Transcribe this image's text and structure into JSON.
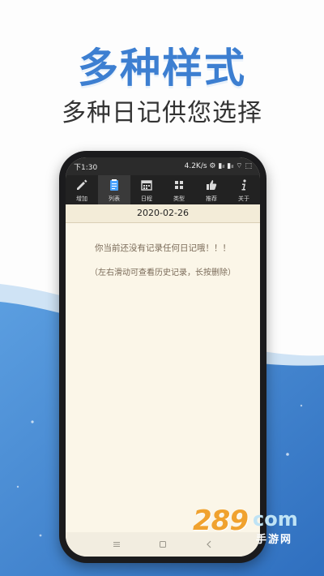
{
  "headline": {
    "main": "多种样式",
    "sub": "多种日记供您选择"
  },
  "status_bar": {
    "time": "下1:30",
    "right": "4.2K/s ⚙ ▮ᵢₗ ▮ᵢₗ ⌔ ⬚"
  },
  "toolbar": {
    "items": [
      {
        "label": "增加",
        "icon": "pencil-icon",
        "active": false
      },
      {
        "label": "列表",
        "icon": "notepad-icon",
        "active": true
      },
      {
        "label": "日程",
        "icon": "calendar-icon",
        "active": false
      },
      {
        "label": "类型",
        "icon": "grid-icon",
        "active": false
      },
      {
        "label": "推荐",
        "icon": "thumbs-up-icon",
        "active": false
      },
      {
        "label": "关于",
        "icon": "info-icon",
        "active": false
      }
    ]
  },
  "date": "2020-02-26",
  "empty_message": "你当前还没有记录任何日记哦！！！",
  "hint_message": "（左右滑动可查看历史记录，长按删除）",
  "watermark": {
    "number": "289",
    "suffix": "com",
    "brand": "手游网"
  },
  "colors": {
    "accent": "#3d7fd1",
    "toolbar_bg": "#222222",
    "page_bg": "#fbf6e8",
    "message": "#7a6a58",
    "watermark_orange": "#f0a22e"
  }
}
